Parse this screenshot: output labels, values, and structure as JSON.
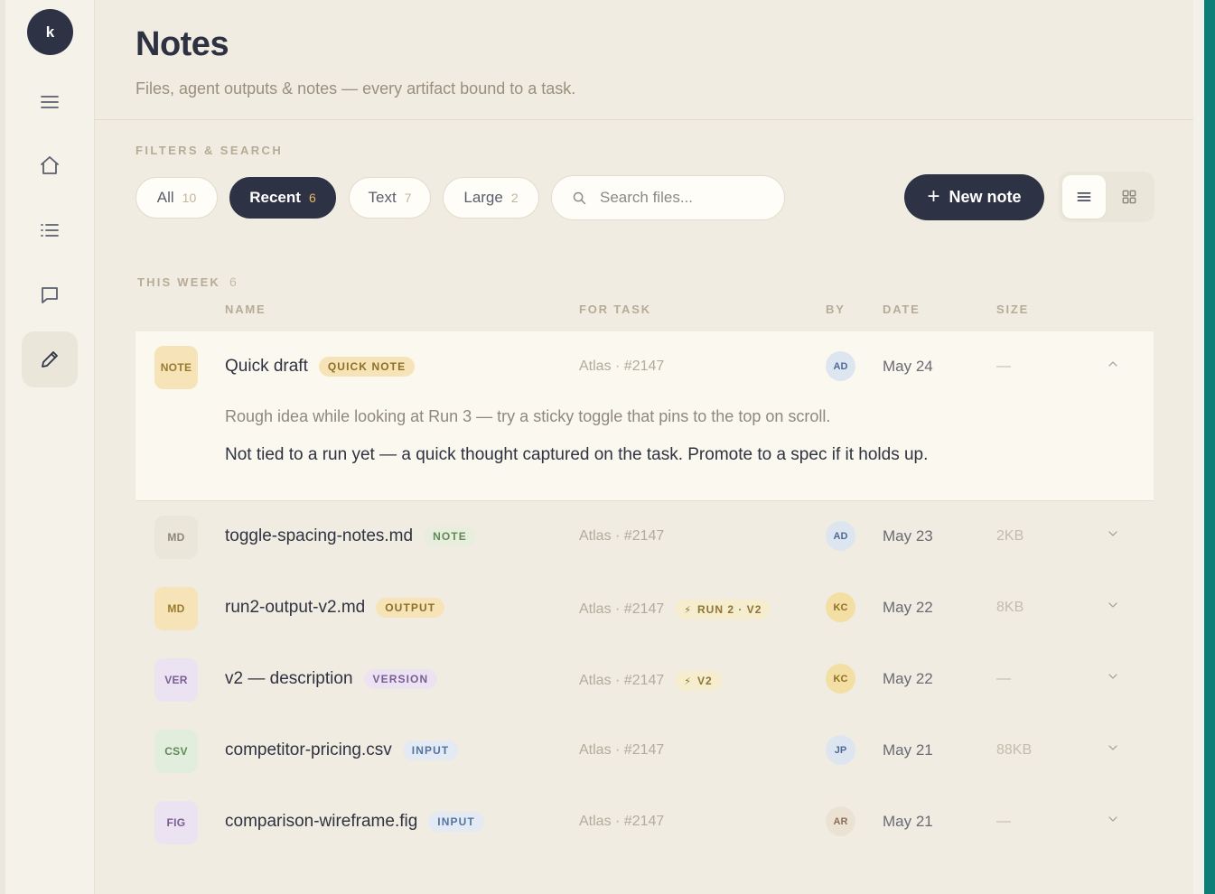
{
  "user": {
    "initial": "k"
  },
  "sidebar": {
    "items": [
      {
        "icon": "menu-icon"
      },
      {
        "icon": "home-icon"
      },
      {
        "icon": "list-icon"
      },
      {
        "icon": "chat-icon"
      },
      {
        "icon": "pencil-icon",
        "active": true
      }
    ]
  },
  "header": {
    "title": "Notes",
    "subtitle": "Files, agent outputs & notes — every artifact bound to a task."
  },
  "filters": {
    "label": "FILTERS & SEARCH",
    "chips": [
      {
        "label": "All",
        "count": "10"
      },
      {
        "label": "Recent",
        "count": "6",
        "active": true
      },
      {
        "label": "Text",
        "count": "7"
      },
      {
        "label": "Large",
        "count": "2"
      }
    ],
    "search_placeholder": "Search files...",
    "new_note_label": "New note",
    "new_note_icon": "+"
  },
  "section": {
    "label": "THIS WEEK",
    "count": "6"
  },
  "columns": {
    "name": "NAME",
    "task": "FOR TASK",
    "by": "BY",
    "date": "DATE",
    "size": "SIZE"
  },
  "rows": [
    {
      "type": "NOTE",
      "name": "Quick draft",
      "tag": "QUICK NOTE",
      "task": "Atlas · #2147",
      "by": "AD",
      "date": "May 24",
      "size": "—",
      "expanded": true,
      "preview": "Rough idea while looking at Run 3 — try a sticky toggle that pins to the top on scroll.",
      "body": "Not tied to a run yet — a quick thought captured on the task. Promote to a spec if it holds up."
    },
    {
      "type": "MD",
      "name": "toggle-spacing-notes.md",
      "tag": "NOTE",
      "task": "Atlas · #2147",
      "by": "AD",
      "date": "May 23",
      "size": "2KB"
    },
    {
      "type": "MD",
      "name": "run2-output-v2.md",
      "tag": "OUTPUT",
      "task": "Atlas · #2147",
      "run": "RUN 2 · V2",
      "by": "KC",
      "date": "May 22",
      "size": "8KB"
    },
    {
      "type": "VER",
      "name": "v2 — description",
      "tag": "VERSION",
      "task": "Atlas · #2147",
      "run": "V2",
      "by": "KC",
      "date": "May 22",
      "size": "—"
    },
    {
      "type": "CSV",
      "name": "competitor-pricing.csv",
      "tag": "INPUT",
      "task": "Atlas · #2147",
      "by": "JP",
      "date": "May 21",
      "size": "88KB"
    },
    {
      "type": "FIG",
      "name": "comparison-wireframe.fig",
      "tag": "INPUT",
      "task": "Atlas · #2147",
      "by": "AR",
      "date": "May 21",
      "size": "—"
    }
  ],
  "colors": {
    "accent_dark": "#2e3245",
    "background": "#f1ece1",
    "teal": "#0f7e78"
  }
}
